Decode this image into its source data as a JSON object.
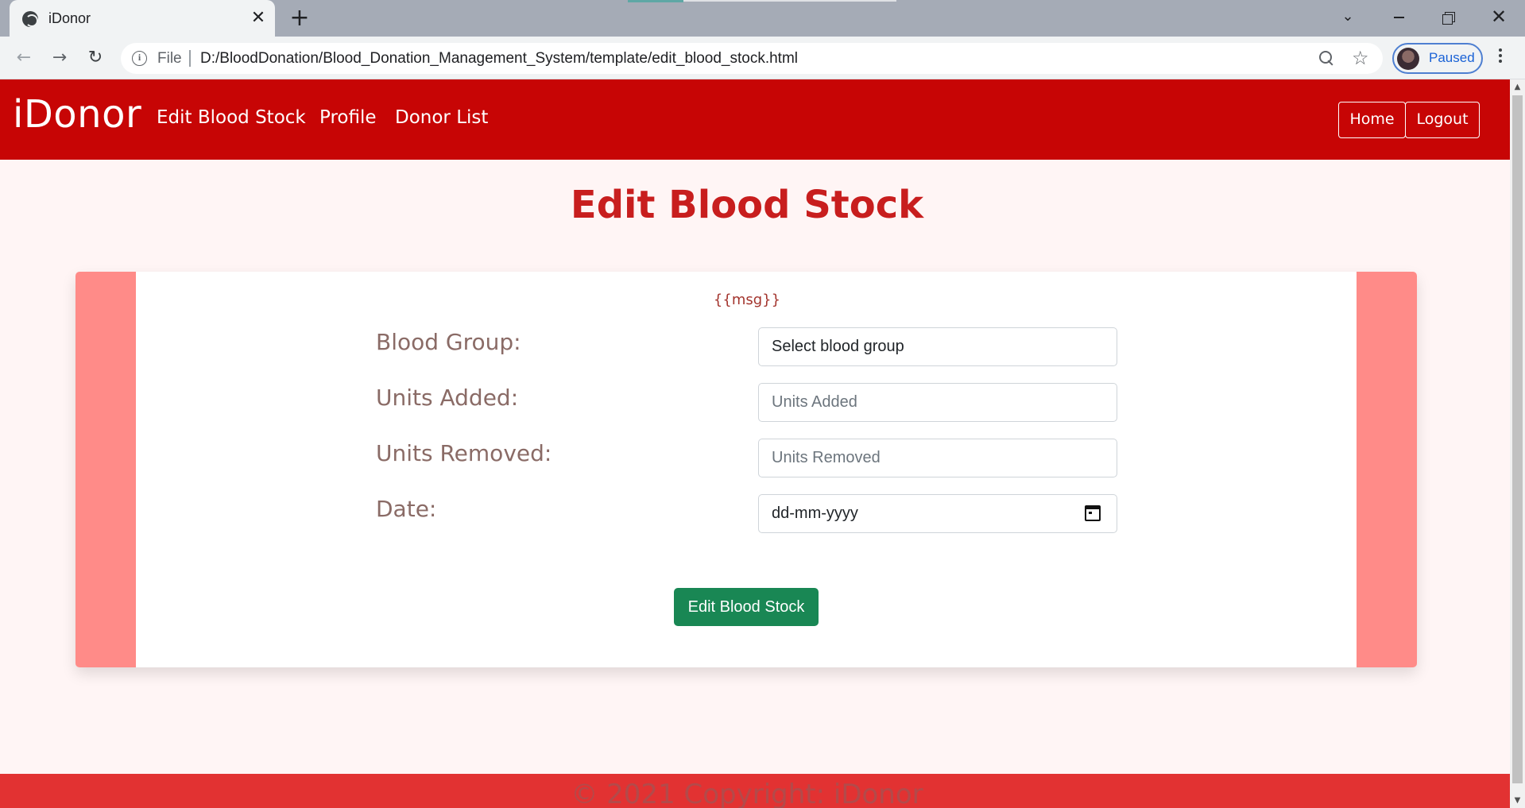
{
  "browser": {
    "tab_title": "iDonor",
    "tab_close": "✕",
    "new_tab": "+",
    "list_tabs": "⌄",
    "close_window": "✕",
    "back": "←",
    "forward": "→",
    "reload": "↻",
    "scheme": "File",
    "url": "D:/BloodDonation/Blood_Donation_Management_System/template/edit_blood_stock.html",
    "info": "i",
    "star": "☆",
    "profile_status": "Paused",
    "scroll_up": "▲",
    "scroll_down": "▼"
  },
  "navbar": {
    "brand": "iDonor",
    "links": [
      "Edit Blood Stock",
      "Profile",
      "Donor List"
    ],
    "home_label": "Home",
    "logout_label": "Logout"
  },
  "page": {
    "title": "Edit Blood Stock"
  },
  "form": {
    "msg": "{{msg}}",
    "fields": [
      {
        "label": "Blood Group:",
        "value": "Select blood group",
        "placeholder": ""
      },
      {
        "label": "Units Added:",
        "value": "",
        "placeholder": "Units Added"
      },
      {
        "label": "Units Removed:",
        "value": "",
        "placeholder": "Units Removed"
      },
      {
        "label": "Date:",
        "value": "dd-mm-yyyy",
        "placeholder": ""
      }
    ],
    "submit_label": "Edit Blood Stock"
  },
  "footer": {
    "text": "© 2021 Copyright: iDonor"
  },
  "colors": {
    "navbar": "#c70505",
    "title": "#c81e1e",
    "card_side": "#ff8b88",
    "submit": "#198754",
    "footer": "#e23232"
  }
}
